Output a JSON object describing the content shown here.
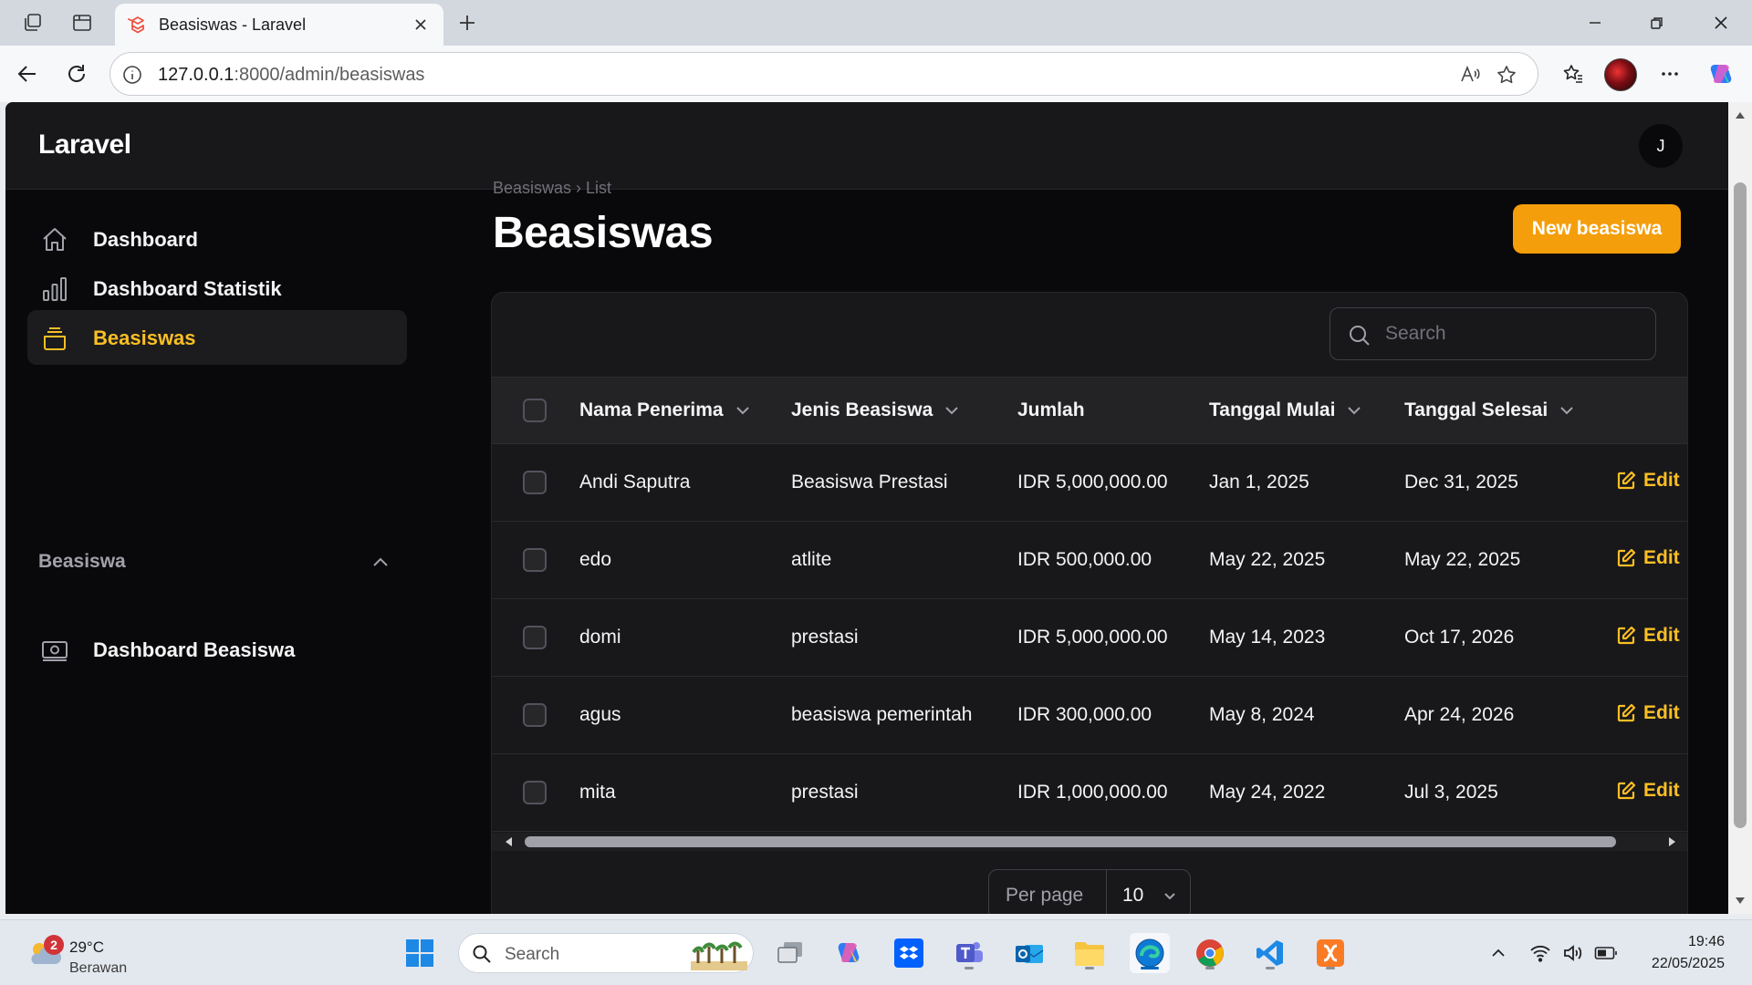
{
  "browser": {
    "tab_title": "Beasiswas - Laravel",
    "url_host": "127.0.0.1",
    "url_path": ":8000/admin/beasiswas"
  },
  "app": {
    "brand": "Laravel",
    "user_initial": "J"
  },
  "sidebar": {
    "items": [
      {
        "label": "Dashboard",
        "icon": "home-icon"
      },
      {
        "label": "Dashboard Statistik",
        "icon": "chart-bar-icon"
      },
      {
        "label": "Beasiswas",
        "icon": "inbox-icon",
        "active": true
      }
    ],
    "group": {
      "label": "Beasiswa",
      "items": [
        {
          "label": "Dashboard Beasiswa",
          "icon": "banknote-icon"
        }
      ]
    }
  },
  "page": {
    "breadcrumb": "Beasiswas  ›  List",
    "title": "Beasiswas",
    "new_button": "New beasiswa"
  },
  "table": {
    "search_placeholder": "Search",
    "columns": [
      "Nama Penerima",
      "Jenis Beasiswa",
      "Jumlah",
      "Tanggal Mulai",
      "Tanggal Selesai"
    ],
    "edit_label": "Edit",
    "rows": [
      {
        "nama": "Andi Saputra",
        "jenis": "Beasiswa Prestasi",
        "jumlah": "IDR 5,000,000.00",
        "mulai": "Jan 1, 2025",
        "selesai": "Dec 31, 2025"
      },
      {
        "nama": "edo",
        "jenis": "atlite",
        "jumlah": "IDR 500,000.00",
        "mulai": "May 22, 2025",
        "selesai": "May 22, 2025"
      },
      {
        "nama": "domi",
        "jenis": "prestasi",
        "jumlah": "IDR 5,000,000.00",
        "mulai": "May 14, 2023",
        "selesai": "Oct 17, 2026"
      },
      {
        "nama": "agus",
        "jenis": "beasiswa pemerintah",
        "jumlah": "IDR 300,000.00",
        "mulai": "May 8, 2024",
        "selesai": "Apr 24, 2026"
      },
      {
        "nama": "mita",
        "jenis": "prestasi",
        "jumlah": "IDR 1,000,000.00",
        "mulai": "May 24, 2022",
        "selesai": "Jul 3, 2025"
      }
    ],
    "per_page_label": "Per page",
    "per_page_value": "10"
  },
  "taskbar": {
    "weather_badge": "2",
    "temperature": "29°C",
    "condition": "Berawan",
    "search_placeholder": "Search",
    "time": "19:46",
    "date": "22/05/2025"
  },
  "colors": {
    "accent": "#f59e0b",
    "active_text": "#fbbf24",
    "background": "#09090b",
    "panel": "#18181b"
  }
}
